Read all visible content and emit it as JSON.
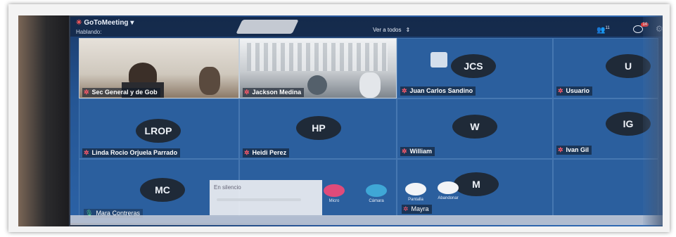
{
  "app": {
    "brand": "GoToMeeting",
    "speaking_label": "Hablando:",
    "view_all_label": "Ver a todos",
    "attendee_count": "11",
    "chat_badge": "14"
  },
  "tiles": [
    {
      "id": "sec-general",
      "name": "Sec General y de Gob",
      "initials": "",
      "video": true,
      "mic": "muted"
    },
    {
      "id": "jackson-medina",
      "name": "Jackson Medina",
      "initials": "",
      "video": true,
      "mic": "muted"
    },
    {
      "id": "juan-carlos",
      "name": "Juan Carlos Sandino",
      "initials": "JCS",
      "video": false,
      "mic": "muted"
    },
    {
      "id": "usuario",
      "name": "Usuario",
      "initials": "U",
      "video": false,
      "mic": "muted"
    },
    {
      "id": "linda",
      "name": "Linda Rocio Orjuela Parrado",
      "initials": "LROP",
      "video": false,
      "mic": "muted"
    },
    {
      "id": "heidi",
      "name": "Heidi Perez",
      "initials": "HP",
      "video": false,
      "mic": "muted"
    },
    {
      "id": "william",
      "name": "William",
      "initials": "W",
      "video": false,
      "mic": "muted"
    },
    {
      "id": "ivan",
      "name": "Ivan Gil",
      "initials": "IG",
      "video": false,
      "mic": "muted"
    },
    {
      "id": "mara",
      "name": "Mara Contreras",
      "initials": "MC",
      "video": false,
      "mic": "live"
    },
    {
      "id": "mayra",
      "name": "Mayra",
      "initials": "M",
      "video": false,
      "mic": "muted"
    }
  ],
  "controls": {
    "silence_label": "En silencio",
    "mic_label": "Micro",
    "camera_label": "Cámara",
    "screen_label": "Pantalla",
    "leave_label": "Abandonar"
  },
  "colors": {
    "tile_bg": "#2b5f9e",
    "muted_mic": "#ff5b6b",
    "live_mic": "#4ed28a",
    "camera_btn": "#3fa7d6",
    "mic_btn": "#e04b7a"
  }
}
